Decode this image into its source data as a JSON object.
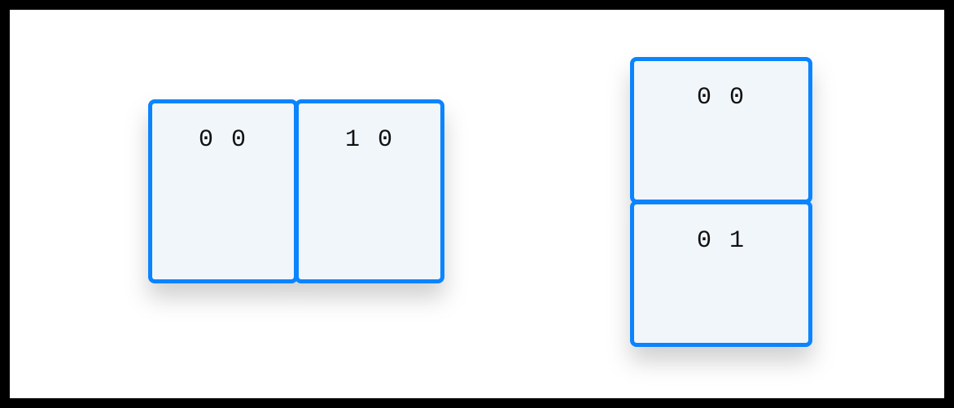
{
  "diagram": {
    "groups": [
      {
        "orientation": "horizontal",
        "cells": [
          {
            "label": "0 0"
          },
          {
            "label": "1 0"
          }
        ]
      },
      {
        "orientation": "vertical",
        "cells": [
          {
            "label": "0 0"
          },
          {
            "label": "0 1"
          }
        ]
      }
    ],
    "colors": {
      "border": "#0a84ff",
      "fill": "#f1f6fb",
      "text": "#111111"
    }
  }
}
